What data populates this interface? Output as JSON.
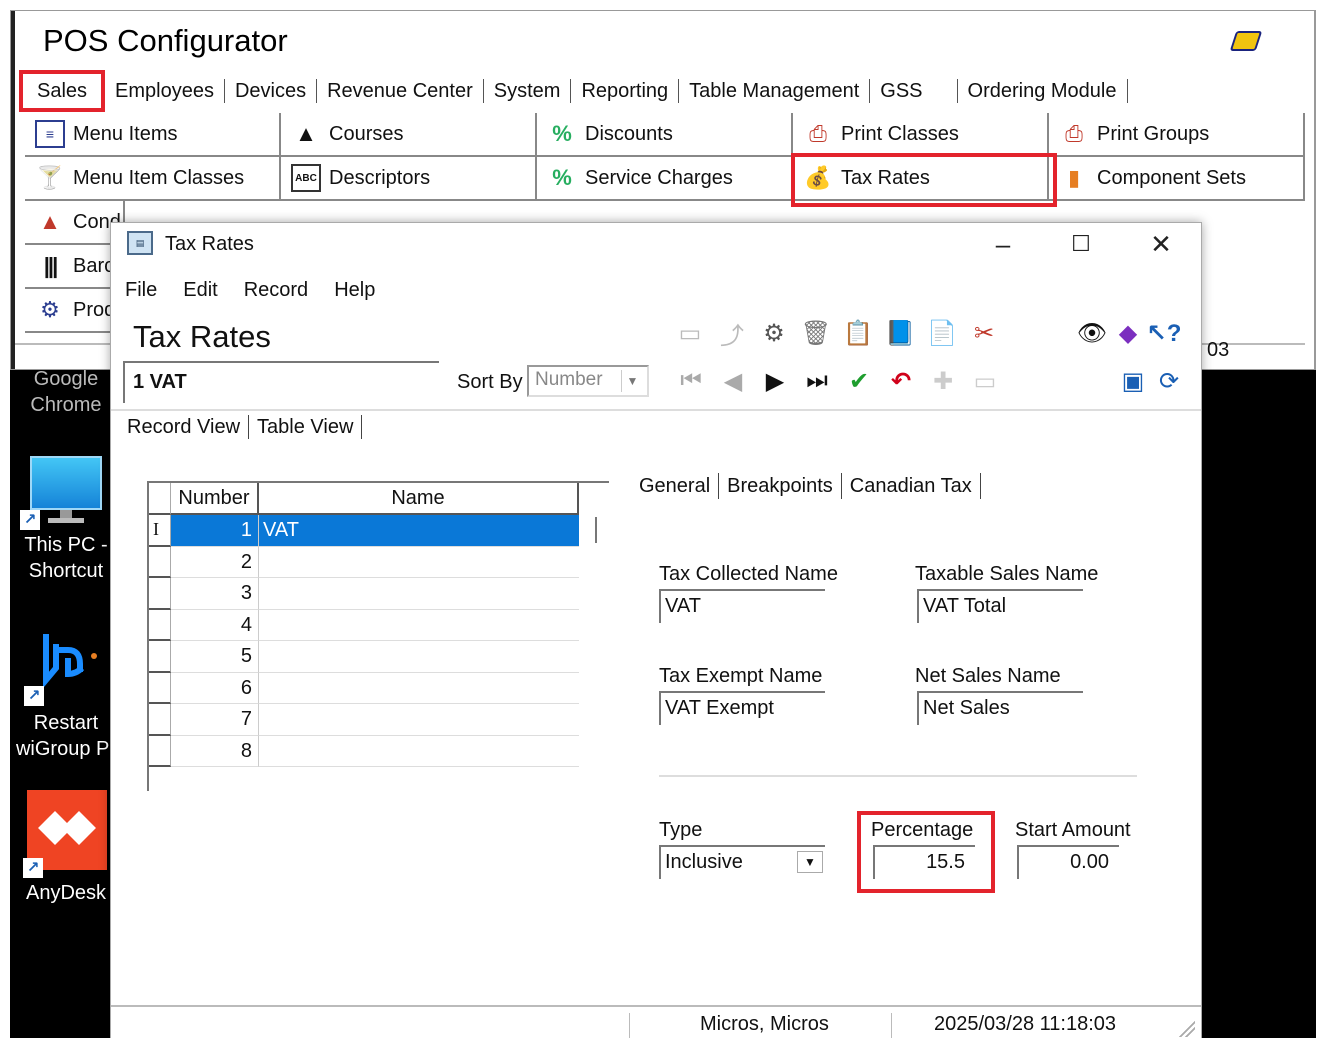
{
  "desktop": {
    "icons": [
      {
        "label": "Google Chrome",
        "icon": "chrome-icon"
      },
      {
        "label": "This PC - Shortcut",
        "line1": "This PC -",
        "line2": "Shortcut",
        "icon": "monitor-icon"
      },
      {
        "label": "Restart wiGroup Pr",
        "line1": "Restart",
        "line2": "wiGroup Pr",
        "icon": "wigroup-icon"
      },
      {
        "label": "AnyDesk",
        "icon": "anydesk-icon"
      }
    ],
    "chrome_line1": "Google",
    "chrome_line2": "Chrome"
  },
  "pos": {
    "title": "POS Configurator",
    "tabs": [
      "Sales",
      "Employees",
      "Devices",
      "Revenue Center",
      "System",
      "Reporting",
      "Table Management",
      "GSS",
      "Ordering Module"
    ],
    "grid": {
      "row1": [
        "Menu Items",
        "Courses",
        "Discounts",
        "Print Classes",
        "Print Groups"
      ],
      "row2": [
        "Menu Item Classes",
        "Descriptors",
        "Service Charges",
        "Tax Rates",
        "Component Sets"
      ],
      "row3_partial": [
        "Cond",
        "Barc",
        "Prod"
      ]
    },
    "status_right": "03",
    "colors": {
      "highlight": "#e3232c"
    }
  },
  "tax_window": {
    "title": "Tax Rates",
    "menu": [
      "File",
      "Edit",
      "Record",
      "Help"
    ],
    "heading": "Tax Rates",
    "current_record": "1 VAT",
    "sort_by_label": "Sort By",
    "sort_by_value": "Number",
    "view_tabs": [
      "Record View",
      "Table View"
    ],
    "grid": {
      "headers": [
        "Number",
        "Name"
      ],
      "rows": [
        {
          "number": "1",
          "name": "VAT"
        },
        {
          "number": "2",
          "name": ""
        },
        {
          "number": "3",
          "name": ""
        },
        {
          "number": "4",
          "name": ""
        },
        {
          "number": "5",
          "name": ""
        },
        {
          "number": "6",
          "name": ""
        },
        {
          "number": "7",
          "name": ""
        },
        {
          "number": "8",
          "name": ""
        }
      ],
      "selected_color": "#0a78d7"
    },
    "detail_tabs": [
      "General",
      "Breakpoints",
      "Canadian Tax"
    ],
    "fields": {
      "tax_collected_name_label": "Tax Collected Name",
      "tax_collected_name": "VAT",
      "taxable_sales_name_label": "Taxable Sales Name",
      "taxable_sales_name": "VAT Total",
      "tax_exempt_name_label": "Tax Exempt Name",
      "tax_exempt_name": "VAT Exempt",
      "net_sales_name_label": "Net Sales Name",
      "net_sales_name": "Net Sales",
      "type_label": "Type",
      "type": "Inclusive",
      "percentage_label": "Percentage",
      "percentage": "15.5",
      "start_amount_label": "Start Amount",
      "start_amount": "0.00"
    },
    "status": {
      "user": "Micros, Micros",
      "timestamp": "2025/03/28 11:18:03"
    }
  }
}
